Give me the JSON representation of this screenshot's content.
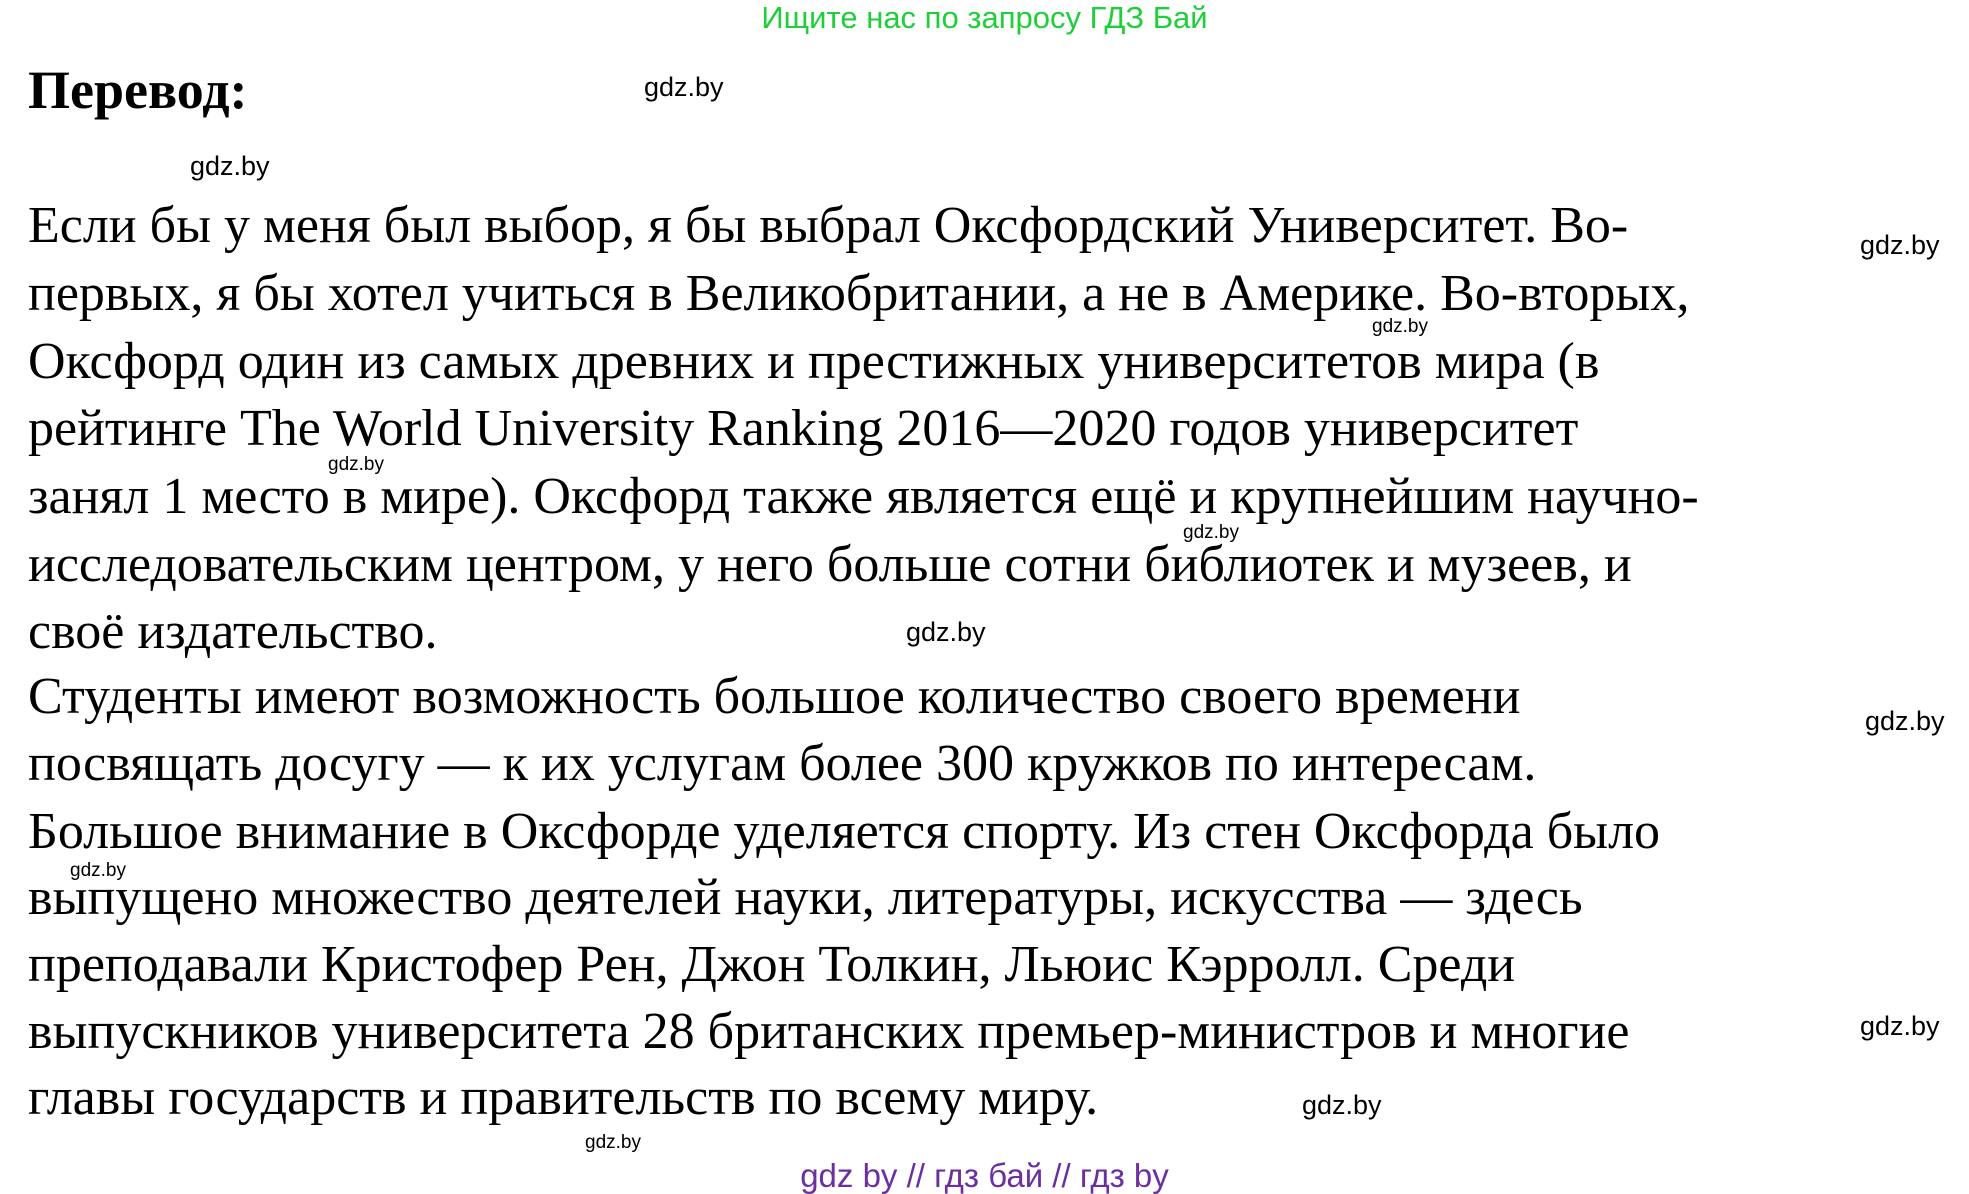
{
  "banner": "Ищите нас по запросу ГДЗ Бай",
  "title": "Перевод:",
  "lines": [
    "Если бы у меня был выбор, я бы выбрал Оксфордский Университет. Во-",
    "первых, я бы хотел учиться в Великобритании, а не в Америке. Во-вторых,",
    "Оксфорд один из самых древних и престижных университетов мира (в",
    "рейтинге The World University Ranking 2016—2020 годов университет",
    "занял 1 место в мире). Оксфорд также является ещё и крупнейшим научно-",
    "исследовательским центром, у него больше сотни библиотек и музеев, и",
    "своё издательство.",
    "Студенты имеют возможность большое количество своего времени",
    "посвящать досугу — к их услугам более 300 кружков по интересам.",
    "Большое внимание в Оксфорде уделяется спорту. Из стен Оксфорда было",
    "выпущено множество деятелей науки, литературы, искусства — здесь",
    "преподавали Кристофер Рен, Джон Толкин, Льюис Кэрролл. Среди",
    "выпускников университета 28 британских премьер-министров и многие",
    "главы государств и правительств по всему миру."
  ],
  "watermark": "gdz.by",
  "footer": "gdz by  //  гдз бай  //  гдз by",
  "colors": {
    "banner": "#1ecf3a",
    "footer": "#6b2fa0",
    "text": "#000000"
  }
}
